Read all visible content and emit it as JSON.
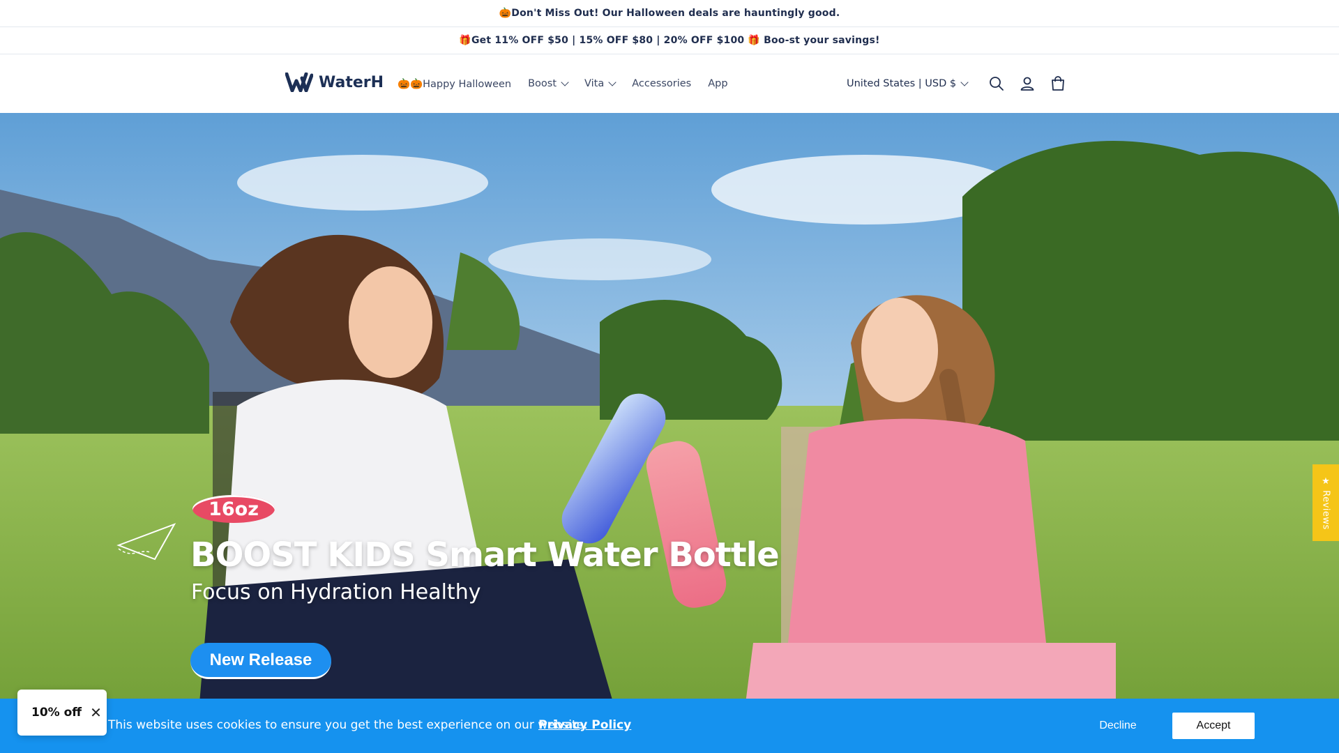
{
  "announcement_1": {
    "icon": "pumpkin-icon",
    "text": "🎃Don't Miss Out! Our Halloween deals are hauntingly good."
  },
  "announcement_2": {
    "icon": "gift-icon",
    "text": "🎁Get 11% OFF $50 | 15% OFF $80 | 20% OFF $100 🎁 Boo-st your savings!"
  },
  "header": {
    "logo_text": "WaterH",
    "nav": [
      {
        "label": "🎃🎃Happy Halloween"
      },
      {
        "label": "Boost"
      },
      {
        "label": "Vita"
      },
      {
        "label": "Accessories"
      },
      {
        "label": "App"
      }
    ],
    "locale": "United States | USD $",
    "icons": [
      "search-icon",
      "account-icon",
      "cart-icon"
    ]
  },
  "hero": {
    "badge": "16oz",
    "title": "BOOST KIDS Smart Water Bottle",
    "subtitle": "Focus on Hydration Healthy",
    "cta": "New Release"
  },
  "reviews_tab": "★ Reviews",
  "cookie": {
    "text": "This website uses cookies to ensure you get the best experience on our website.",
    "link": "Privacy Policy",
    "decline": "Decline",
    "accept": "Accept"
  },
  "discount_popup": {
    "label": "10% off",
    "close": "✕"
  },
  "colors": {
    "brand_blue": "#1592ef",
    "navy": "#1c2f55",
    "badge_pink": "#e84a64",
    "reviews_yellow": "#f5c518"
  }
}
